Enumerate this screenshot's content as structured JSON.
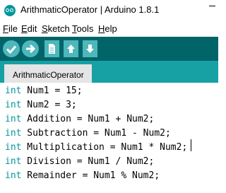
{
  "window": {
    "title": "ArithmaticOperator | Arduino 1.8.1"
  },
  "menu": [
    {
      "mnemonic": "F",
      "rest": "ile"
    },
    {
      "mnemonic": "E",
      "rest": "dit"
    },
    {
      "mnemonic": "S",
      "rest": "ketch"
    },
    {
      "mnemonic": "T",
      "rest": "ools"
    },
    {
      "mnemonic": "H",
      "rest": "elp"
    }
  ],
  "toolbar": {
    "icons": [
      "check-icon",
      "right-arrow-icon",
      "new-file-icon",
      "up-arrow-icon",
      "down-arrow-icon"
    ],
    "colors": {
      "toolbar_bg": "#006468",
      "button": "#4db7bb",
      "tab_strip": "#17a1a5",
      "keyword": "#00979c"
    }
  },
  "tabs": [
    {
      "label": "ArithmaticOperator",
      "active": true
    }
  ],
  "editor": {
    "lines": [
      {
        "kw": "int",
        "rest": " Num1 = 15;"
      },
      {
        "kw": "int",
        "rest": " Num2 = 3;"
      },
      {
        "kw": "int",
        "rest": " Addition = Num1 + Num2;"
      },
      {
        "kw": "int",
        "rest": " Subtraction = Num1 - Num2;"
      },
      {
        "kw": "int",
        "rest": " Multiplication = Num1 * Num2;"
      },
      {
        "kw": "int",
        "rest": " Division = Num1 / Num2;"
      },
      {
        "kw": "int",
        "rest": " Remainder = Num1 % Num2;"
      }
    ]
  }
}
